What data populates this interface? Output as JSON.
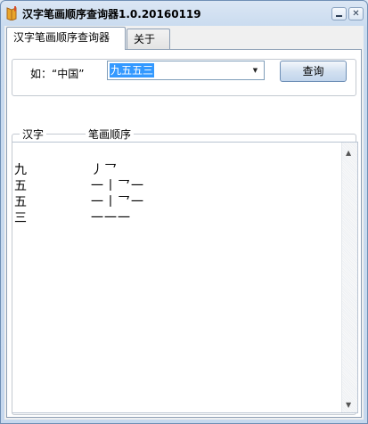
{
  "window": {
    "title": "汉字笔画顺序查询器1.0.20160119",
    "accent": "#6f8fb5"
  },
  "tabs": [
    {
      "label": "汉字笔画顺序查询器",
      "selected": true
    },
    {
      "label": "关于",
      "selected": false
    }
  ],
  "query": {
    "example_label": "如：“中国”",
    "input_value": "九五五三",
    "button_label": "查询"
  },
  "results": {
    "header_hanzi": "汉字",
    "header_strokes": "笔画顺序",
    "rows": [
      {
        "char": "九",
        "strokes": "丿乛"
      },
      {
        "char": "五",
        "strokes": "一丨乛一"
      },
      {
        "char": "五",
        "strokes": "一丨乛一"
      },
      {
        "char": "三",
        "strokes": "一一一"
      }
    ]
  }
}
